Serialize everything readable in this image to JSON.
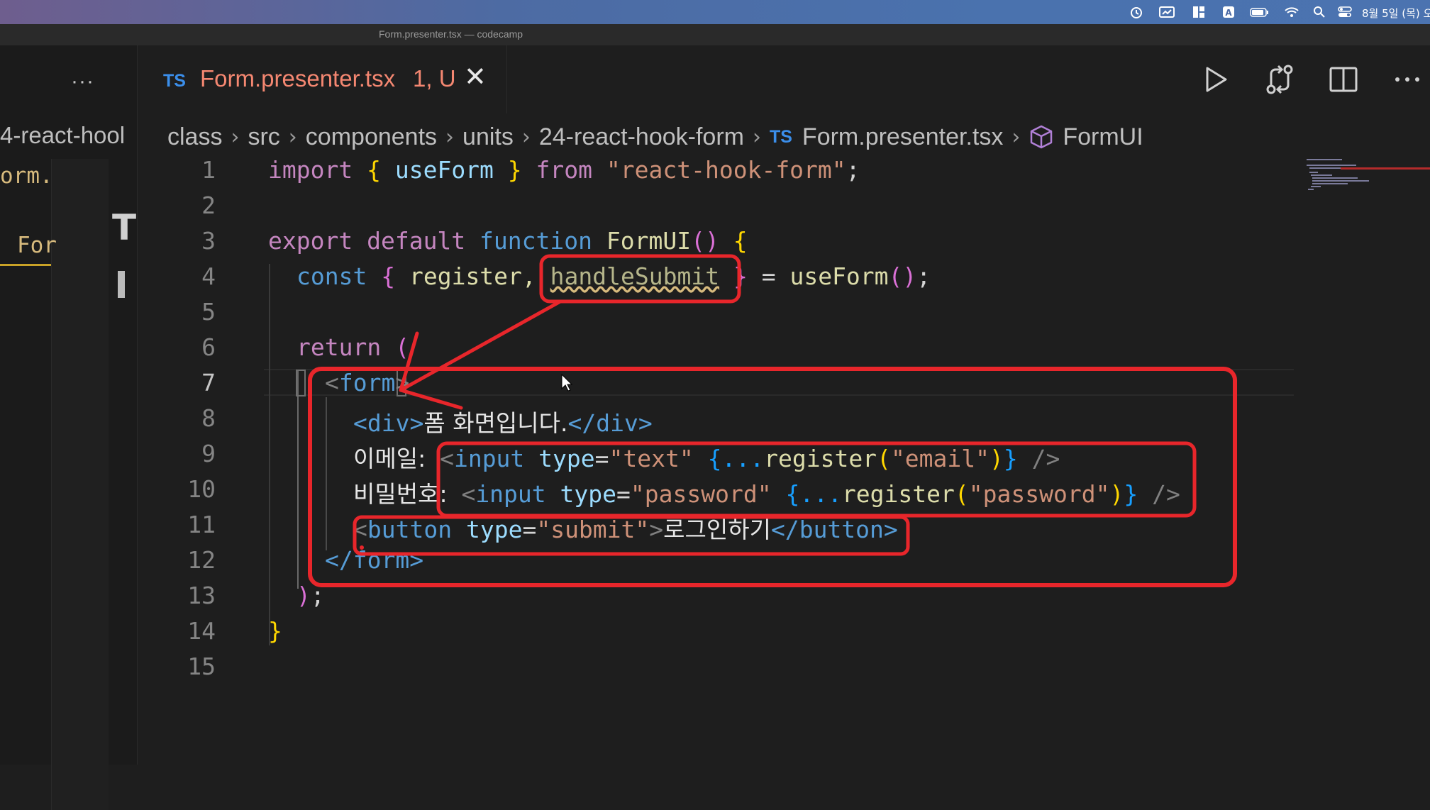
{
  "menubar": {
    "clock": "8월 5일 (목) 오"
  },
  "window": {
    "title": "Form.presenter.tsx — codecamp"
  },
  "sidebar": {
    "more": "···",
    "crumb_fragment": "4-react-hool",
    "file_fragment": "orm.",
    "tab_fragment": "For"
  },
  "tab": {
    "lang": "TS",
    "filename": "Form.presenter.tsx",
    "badge": "1, U"
  },
  "breadcrumb": {
    "items": [
      "class",
      "src",
      "components",
      "units",
      "24-react-hook-form"
    ],
    "file_lang": "TS",
    "file": "Form.presenter.tsx",
    "symbol": "FormUI"
  },
  "editor": {
    "line_numbers": [
      "1",
      "2",
      "3",
      "4",
      "5",
      "6",
      "7",
      "8",
      "9",
      "10",
      "11",
      "12",
      "13",
      "14",
      "15"
    ],
    "active_line": "7",
    "tokens": {
      "l1_import": "import",
      "l1_open": "{",
      "l1_useform": "useForm",
      "l1_close": "}",
      "l1_from": "from",
      "l1_str": "\"react-hook-form\"",
      "l1_semi": ";",
      "l3_export": "export",
      "l3_default": "default",
      "l3_function": "function",
      "l3_name": "FormUI",
      "l3_parens": "()",
      "l3_brace": "{",
      "l4_const": "const",
      "l4_open": "{",
      "l4_register": "register,",
      "l4_handle": "handleSubmit",
      "l4_close": "}",
      "l4_eq": "=",
      "l4_call": "useForm",
      "l4_parens": "()",
      "l4_semi": ";",
      "l6_return": "return",
      "l6_paren": "(",
      "l7_lt": "<",
      "l7_form": "form",
      "l7_gt": ">",
      "l8_open": "<div>",
      "l8_text": "폼 화면입니다.",
      "l8_close": "</div>",
      "l9_label": "이메일:",
      "l9_lt": "<",
      "l9_input": "input",
      "l9_type": "type",
      "l9_eq": "=",
      "l9_val": "\"text\"",
      "l9_spread_open": "{...",
      "l9_register": "register",
      "l9_paren_open": "(",
      "l9_arg": "\"email\"",
      "l9_paren_close": ")",
      "l9_spread_close": "}",
      "l9_end": "/>",
      "l10_label": "비밀번호:",
      "l10_lt": "<",
      "l10_input": "input",
      "l10_type": "type",
      "l10_eq": "=",
      "l10_val": "\"password\"",
      "l10_spread_open": "{...",
      "l10_register": "register",
      "l10_paren_open": "(",
      "l10_arg": "\"password\"",
      "l10_paren_close": ")",
      "l10_spread_close": "}",
      "l10_end": "/>",
      "l11_lt": "<",
      "l11_button": "button",
      "l11_type": "type",
      "l11_eq": "=",
      "l11_val": "\"submit\"",
      "l11_gt": ">",
      "l11_text": "로그인하기",
      "l11_close": "</button>",
      "l12_close": "</form>",
      "l13_paren": ")",
      "l13_semi": ";",
      "l14_brace": "}"
    }
  },
  "colors": {
    "annotation_red": "#e8262b",
    "tab_modified": "#f48771",
    "ts_blue": "#3b8eea"
  },
  "icons": [
    "run-icon",
    "git-compare-icon",
    "split-editor-icon",
    "more-actions-icon",
    "close-icon",
    "symbol-cube-icon"
  ]
}
